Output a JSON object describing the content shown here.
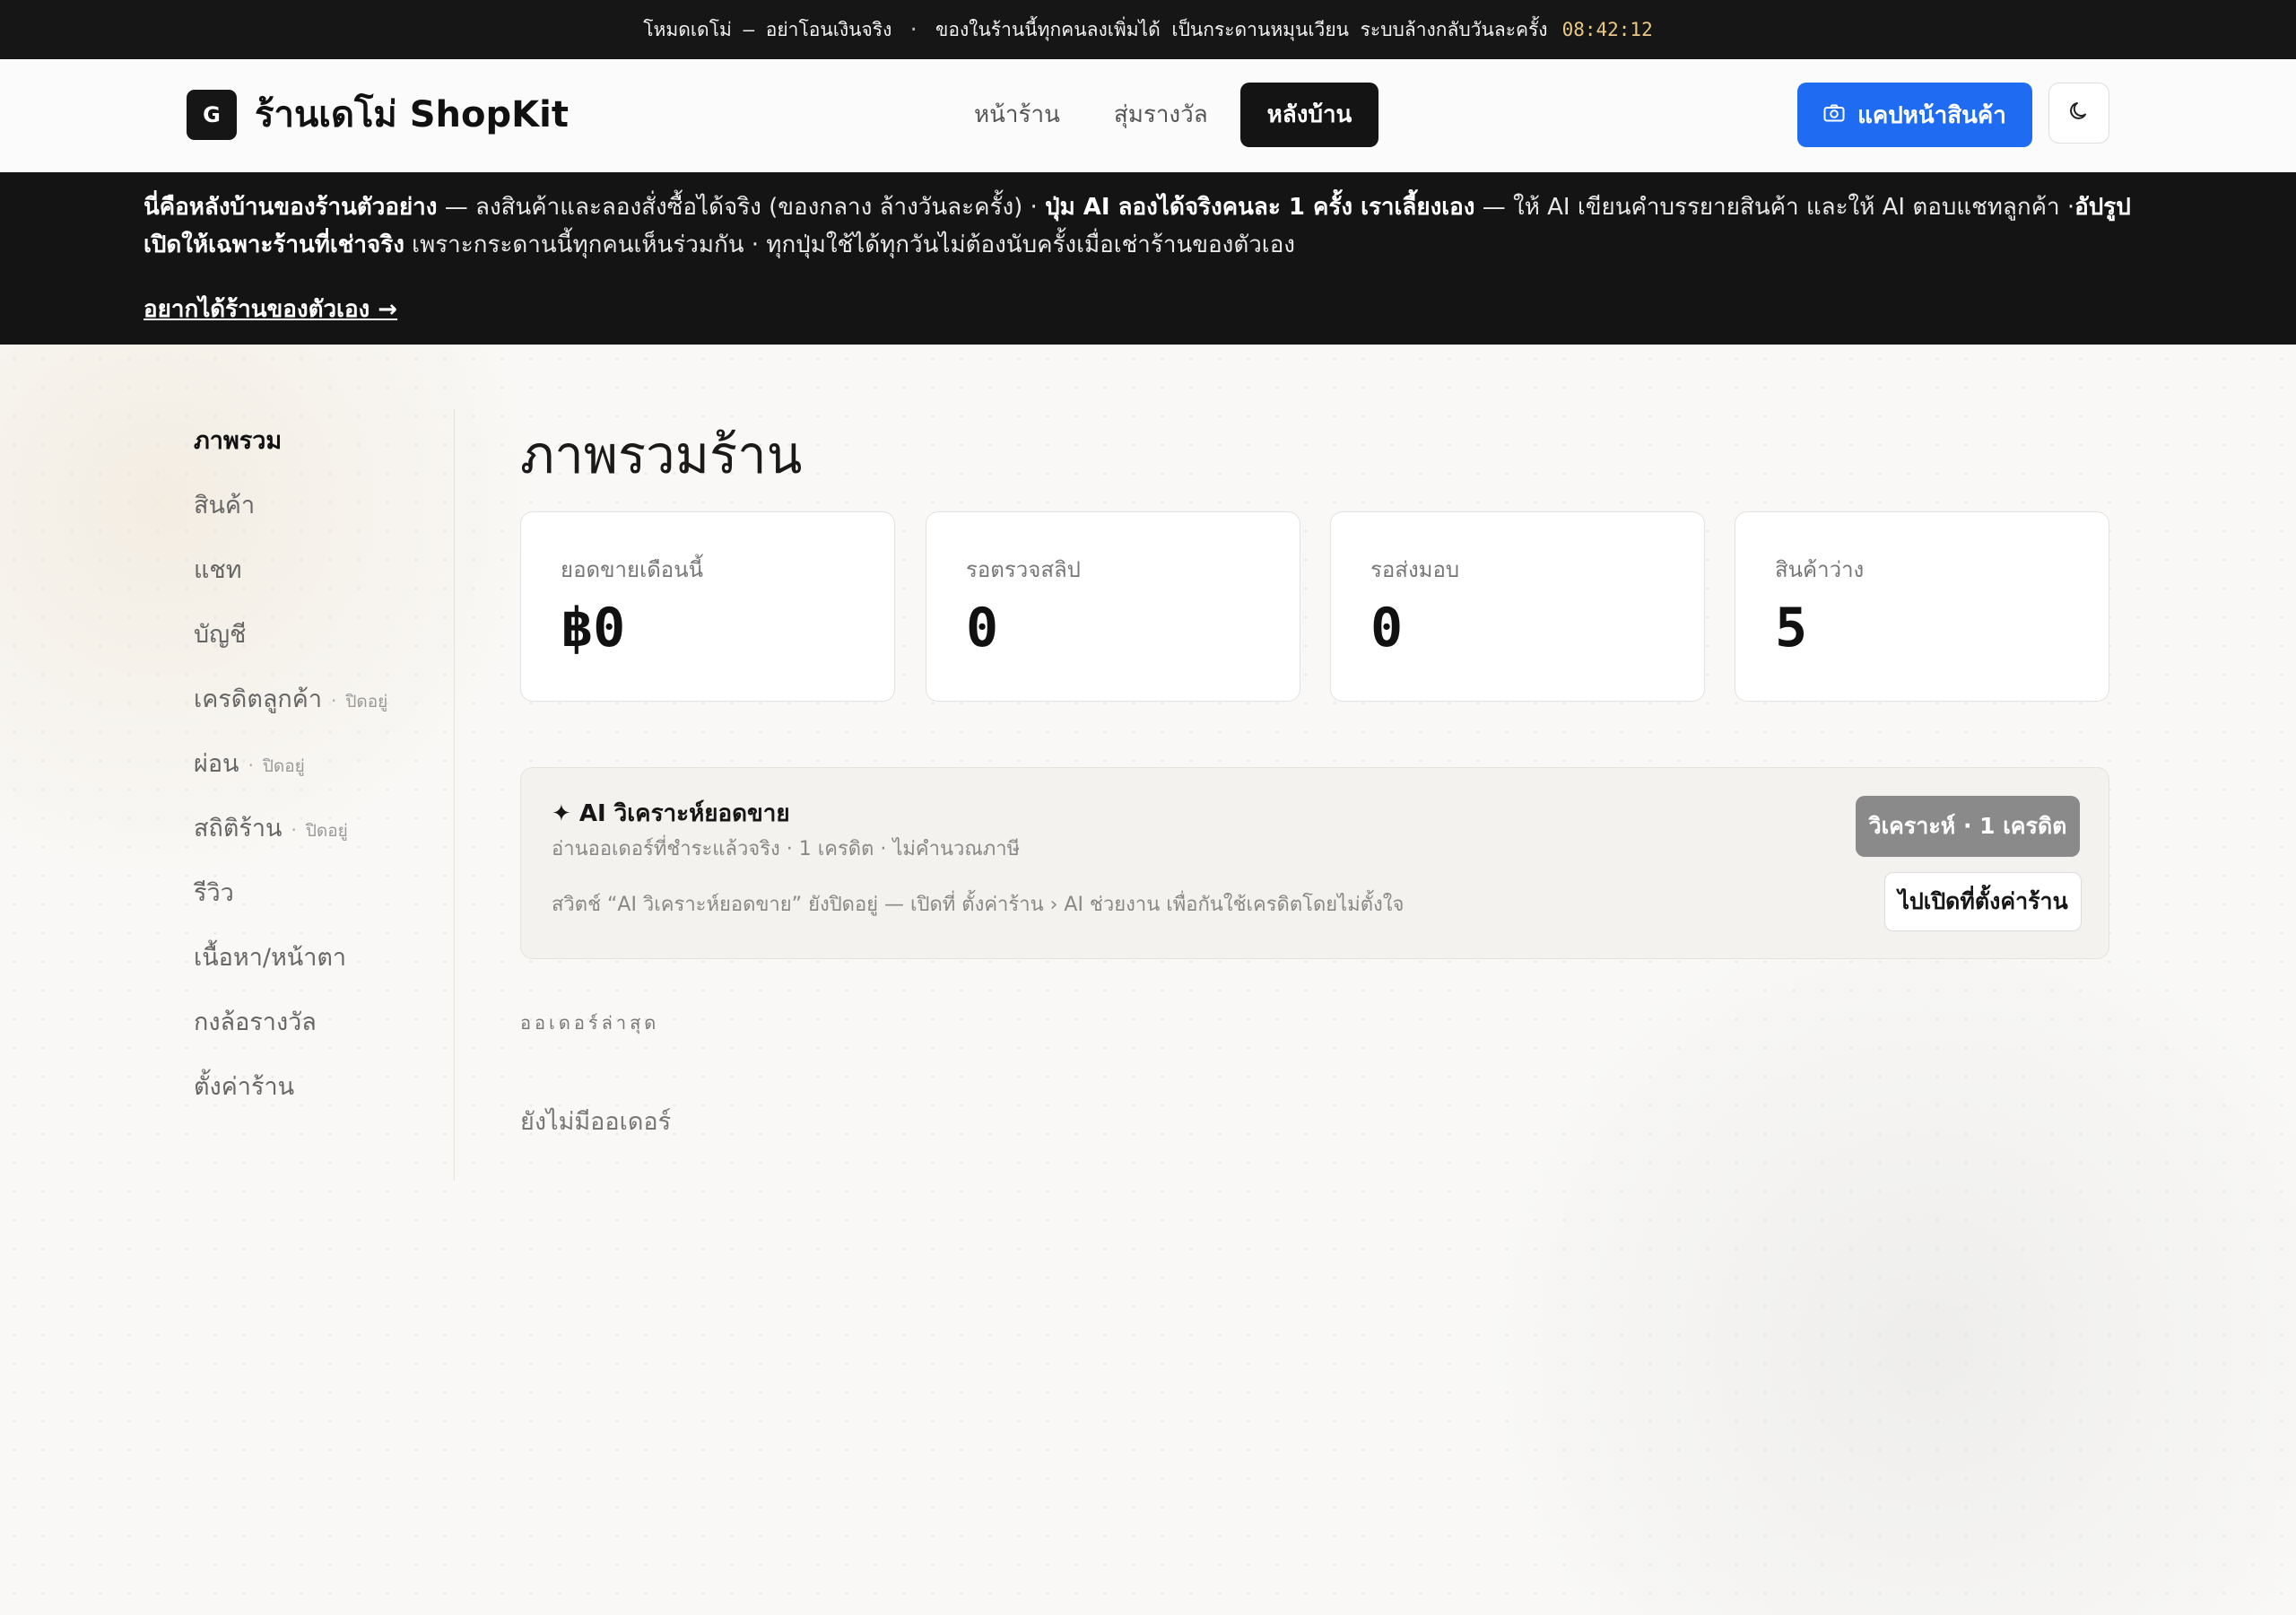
{
  "topbar": {
    "mode": "โหมดเดโม่ — อย่าโอนเงินจริง",
    "separator": "·",
    "message": "ของในร้านนี้ทุกคนลงเพิ่มได้ เป็นกระดานหมุนเวียน ระบบล้างกลับวันละครั้ง",
    "clock": "08:42:12"
  },
  "header": {
    "logo_letter": "G",
    "brand": "ร้านเดโม่ ShopKit",
    "nav": [
      {
        "label": "หน้าร้าน",
        "active": false
      },
      {
        "label": "สุ่มรางวัล",
        "active": false
      },
      {
        "label": "หลังบ้าน",
        "active": true
      }
    ],
    "snap_button": "แคปหน้าสินค้า",
    "snap_icon": "camera-icon",
    "theme_icon": "moon-icon"
  },
  "notice": {
    "part1_bold": "นี่คือหลังบ้านของร้านตัวอย่าง",
    "part2": " — ลงสินค้าและลองสั่งซื้อได้จริง (ของกลาง ล้างวันละครั้ง) · ",
    "part3_bold": "ปุ่ม AI ลองได้จริงคนละ 1 ครั้ง เราเลี้ยงเอง",
    "part4": " — ให้ AI เขียนคำบรรยายสินค้า และให้ AI ตอบแชทลูกค้า ·",
    "part5_bold": "อัปรูปเปิดให้เฉพาะร้านที่เช่าจริง",
    "part6": " เพราะกระดานนี้ทุกคนเห็นร่วมกัน · ทุกปุ่มใช้ได้ทุกวันไม่ต้องนับครั้งเมื่อเช่าร้านของตัวเอง",
    "cta": "อยากได้ร้านของตัวเอง →"
  },
  "sidebar": {
    "items": [
      {
        "label": "ภาพรวม",
        "active": true,
        "sub": ""
      },
      {
        "label": "สินค้า",
        "active": false,
        "sub": ""
      },
      {
        "label": "แชท",
        "active": false,
        "sub": ""
      },
      {
        "label": "บัญชี",
        "active": false,
        "sub": ""
      },
      {
        "label": "เครดิตลูกค้า",
        "active": false,
        "sub": "ปิดอยู่"
      },
      {
        "label": "ผ่อน",
        "active": false,
        "sub": "ปิดอยู่"
      },
      {
        "label": "สถิติร้าน",
        "active": false,
        "sub": "ปิดอยู่"
      },
      {
        "label": "รีวิว",
        "active": false,
        "sub": ""
      },
      {
        "label": "เนื้อหา/หน้าตา",
        "active": false,
        "sub": ""
      },
      {
        "label": "กงล้อรางวัล",
        "active": false,
        "sub": ""
      },
      {
        "label": "ตั้งค่าร้าน",
        "active": false,
        "sub": ""
      }
    ]
  },
  "main": {
    "title": "ภาพรวมร้าน",
    "stats": [
      {
        "label": "ยอดขายเดือนนี้",
        "value": "฿0"
      },
      {
        "label": "รอตรวจสลิป",
        "value": "0"
      },
      {
        "label": "รอส่งมอบ",
        "value": "0"
      },
      {
        "label": "สินค้าว่าง",
        "value": "5"
      }
    ],
    "ai": {
      "title": "✦ AI วิเคราะห์ยอดขาย",
      "subtitle": "อ่านออเดอร์ที่ชำระแล้วจริง · 1 เครดิต · ไม่คำนวณภาษี",
      "note": "สวิตช์ “AI วิเคราะห์ยอดขาย” ยังปิดอยู่ — เปิดที่ ตั้งค่าร้าน › AI ช่วยงาน เพื่อกันใช้เครดิตโดยไม่ตั้งใจ",
      "analyze_button": "วิเคราะห์ · 1 เครดิต",
      "settings_button": "ไปเปิดที่ตั้งค่าร้าน"
    },
    "orders_label": "ออเดอร์ล่าสุด",
    "orders_empty": "ยังไม่มีออเดอร์"
  }
}
